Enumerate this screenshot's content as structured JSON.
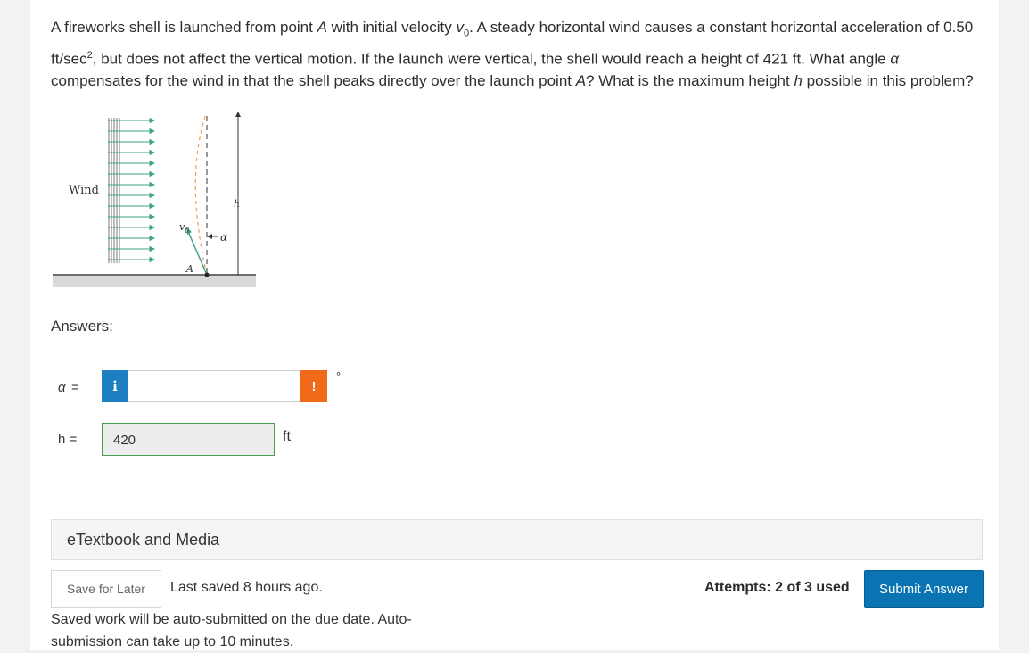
{
  "question": {
    "part1": "A fireworks shell is launched from point ",
    "point_a": "A",
    "part2": " with initial velocity ",
    "v0": "v",
    "v0_sub": "0",
    "part3": ". A steady horizontal wind causes a constant horizontal acceleration of 0.50 ft/sec",
    "sup": "2",
    "part4": ", but does not affect the vertical motion. If the launch were vertical, the shell would reach a height of 421 ft. What angle ",
    "alpha": "α",
    "part5": " compensates for the wind in that the shell peaks directly over the launch point ",
    "point_a2": "A",
    "part6": "? What is the maximum height ",
    "h": "h",
    "part7": " possible in this problem?"
  },
  "figure": {
    "wind_label": "Wind",
    "h_label": "h",
    "alpha_label": "α",
    "v0_label": "v",
    "v0_sub": "0",
    "a_label": "A"
  },
  "answers": {
    "label": "Answers:",
    "alpha_symbol": "α",
    "alpha_eq": "=",
    "info_icon": "i",
    "warn_icon": "!",
    "alpha_value": "",
    "alpha_unit": "°",
    "h_label": "h =",
    "h_value": "420",
    "h_unit": "ft"
  },
  "etextbook": {
    "label": "eTextbook and Media"
  },
  "footer": {
    "save_label": "Save for Later",
    "last_saved": "Last saved 8 hours ago.",
    "auto_submit": "Saved work will be auto-submitted on the due date. Auto-submission can take up to 10 minutes.",
    "attempts": "Attempts: 2 of 3 used",
    "submit_label": "Submit Answer"
  },
  "colors": {
    "submit": "#0a73b1",
    "info": "#1d7fc1",
    "warning": "#f06a1a",
    "correct_border": "#4a9c54",
    "wind_arrows": "#3fa386",
    "trajectory": "#e8a060"
  }
}
